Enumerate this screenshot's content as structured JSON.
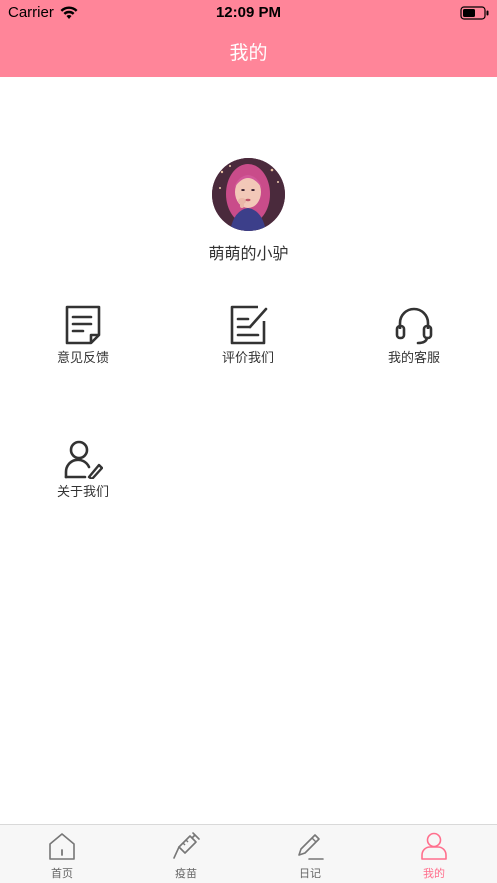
{
  "status_bar": {
    "carrier": "Carrier",
    "time": "12:09 PM"
  },
  "nav": {
    "title": "我的"
  },
  "profile": {
    "username": "萌萌的小驴"
  },
  "menu": {
    "items": [
      {
        "label": "意见反馈",
        "icon": "feedback-icon"
      },
      {
        "label": "评价我们",
        "icon": "rate-icon"
      },
      {
        "label": "我的客服",
        "icon": "headset-icon"
      },
      {
        "label": "关于我们",
        "icon": "about-user-icon"
      }
    ]
  },
  "tabbar": {
    "items": [
      {
        "label": "首页",
        "icon": "home-icon",
        "active": false
      },
      {
        "label": "疫苗",
        "icon": "syringe-icon",
        "active": false
      },
      {
        "label": "日记",
        "icon": "pencil-icon",
        "active": false
      },
      {
        "label": "我的",
        "icon": "user-icon",
        "active": true
      }
    ]
  },
  "colors": {
    "header": "#ff8599",
    "accent": "#ff6f8d",
    "icon": "#333333",
    "tab_icon": "#777777"
  }
}
